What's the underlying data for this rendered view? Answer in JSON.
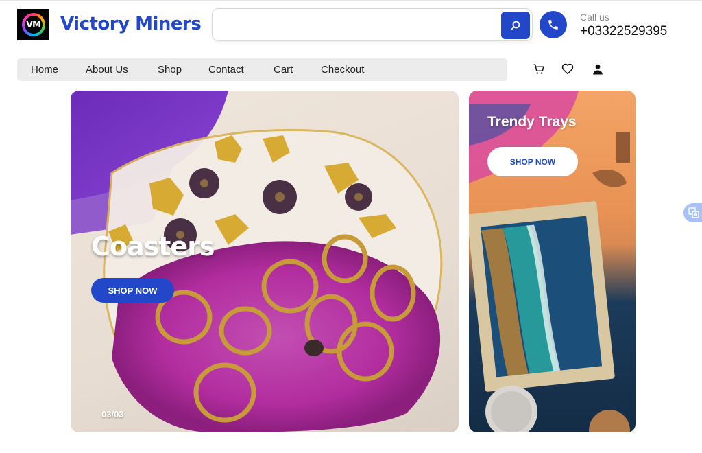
{
  "brand": {
    "name": "Victory Miners",
    "logo_text": "VM"
  },
  "search": {
    "placeholder": ""
  },
  "contact": {
    "label": "Call us",
    "phone": "+03322529395"
  },
  "nav": {
    "items": [
      "Home",
      "About Us",
      "Shop",
      "Contact",
      "Cart",
      "Checkout"
    ]
  },
  "header_icons": [
    "cart-icon",
    "heart-icon",
    "user-icon"
  ],
  "hero": {
    "main": {
      "title": "Coasters",
      "button": "SHOP NOW",
      "counter": "03/03"
    },
    "side": {
      "title": "Trendy Trays",
      "button": "SHOP NOW"
    }
  },
  "colors": {
    "accent": "#2248c9",
    "nav_bg": "#ececec",
    "hero_pink": "#b22d9f",
    "resin_gold": "#d5a72a"
  }
}
